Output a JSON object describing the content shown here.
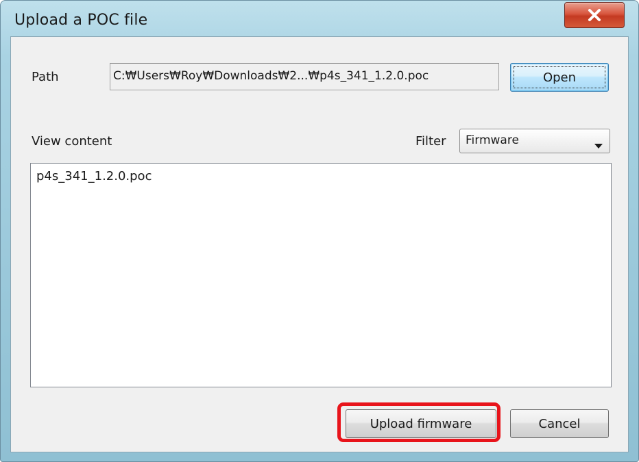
{
  "window": {
    "title": "Upload a POC file",
    "close_icon": "close-x-icon"
  },
  "path": {
    "label": "Path",
    "value": "C:₩Users₩Roy₩Downloads₩2...₩p4s_341_1.2.0.poc",
    "open_label": "Open"
  },
  "view": {
    "label": "View content",
    "filter_label": "Filter",
    "filter_selected": "Firmware",
    "dropdown_icon": "chevron-down-icon",
    "items": [
      "p4s_341_1.2.0.poc"
    ]
  },
  "actions": {
    "upload_label": "Upload firmware",
    "cancel_label": "Cancel"
  },
  "colors": {
    "highlight": "#e8141b",
    "close_button": "#c43a22",
    "frame": "#9ac8da"
  }
}
